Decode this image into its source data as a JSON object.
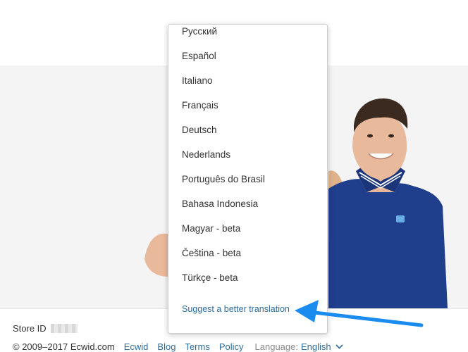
{
  "footer": {
    "store_id_label": "Store ID",
    "copyright": "© 2009–2017 Ecwid.com",
    "links": [
      "Ecwid",
      "Blog",
      "Terms",
      "Policy"
    ],
    "language_label": "Language:",
    "language_value": "English"
  },
  "dropdown": {
    "languages": [
      "Русский",
      "Español",
      "Italiano",
      "Français",
      "Deutsch",
      "Nederlands",
      "Português do Brasil",
      "Bahasa Indonesia",
      "Magyar - beta",
      "Čeština - beta",
      "Türkçe - beta"
    ],
    "suggest_link": "Suggest a better translation"
  },
  "colors": {
    "link": "#2f6c9b",
    "arrow": "#1a8cf0",
    "polo": "#1f3f8c"
  }
}
